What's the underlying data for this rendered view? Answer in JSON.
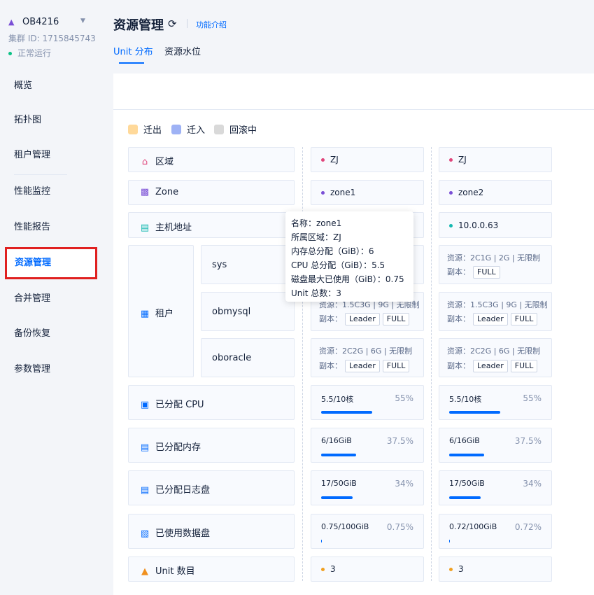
{
  "cluster": {
    "name": "OB4216",
    "id_text": "集群 ID: 1715845743",
    "status": "正常运行",
    "status_color": "#0ac185"
  },
  "nav": [
    {
      "label": "概览"
    },
    {
      "label": "拓扑图"
    },
    {
      "label": "租户管理"
    },
    {
      "label": "性能监控"
    },
    {
      "label": "性能报告"
    },
    {
      "label": "资源管理"
    },
    {
      "label": "合并管理"
    },
    {
      "label": "备份恢复"
    },
    {
      "label": "参数管理"
    }
  ],
  "header": {
    "title": "资源管理",
    "intro_link": "功能介绍"
  },
  "tabs": [
    {
      "label": "Unit 分布",
      "active": true
    },
    {
      "label": "资源水位",
      "active": false
    }
  ],
  "legend": [
    {
      "label": "迁出",
      "color": "#ffd99a"
    },
    {
      "label": "迁入",
      "color": "#9eb2f5"
    },
    {
      "label": "回滚中",
      "color": "#d9d9d9"
    }
  ],
  "rows": {
    "region": "区域",
    "zone": "Zone",
    "host": "主机地址",
    "tenant": "租户",
    "cpu": "已分配 CPU",
    "memory": "已分配内存",
    "log_disk": "已分配日志盘",
    "data_disk": "已使用数据盘",
    "unit_count": "Unit 数目"
  },
  "tenants": [
    "sys",
    "obmysql",
    "oboracle"
  ],
  "replica_label": "副本：",
  "zones": [
    {
      "region": "ZJ",
      "zone": "zone1",
      "host": "",
      "tenants": [
        {
          "resource": "",
          "tags": []
        },
        {
          "resource": "资源：1.5C3G | 9G | 无限制",
          "tags": [
            "Leader",
            "FULL"
          ]
        },
        {
          "resource": "资源：2C2G | 6G | 无限制",
          "tags": [
            "Leader",
            "FULL"
          ]
        }
      ],
      "cpu": {
        "text": "5.5/10核",
        "pct": "55%",
        "fraction": 0.55
      },
      "memory": {
        "text": "6/16GiB",
        "pct": "37.5%",
        "fraction": 0.375
      },
      "log_disk": {
        "text": "17/50GiB",
        "pct": "34%",
        "fraction": 0.34
      },
      "data_disk": {
        "text": "0.75/100GiB",
        "pct": "0.75%",
        "fraction": 0.0075
      },
      "unit_count": "3"
    },
    {
      "region": "ZJ",
      "zone": "zone2",
      "host": "10.0.0.63",
      "tenants": [
        {
          "resource": "资源：2C1G | 2G | 无限制",
          "tags": [
            "FULL"
          ]
        },
        {
          "resource": "资源：1.5C3G | 9G | 无限制",
          "tags": [
            "Leader",
            "FULL"
          ]
        },
        {
          "resource": "资源：2C2G | 6G | 无限制",
          "tags": [
            "Leader",
            "FULL"
          ]
        }
      ],
      "cpu": {
        "text": "5.5/10核",
        "pct": "55%",
        "fraction": 0.55
      },
      "memory": {
        "text": "6/16GiB",
        "pct": "37.5%",
        "fraction": 0.375
      },
      "log_disk": {
        "text": "17/50GiB",
        "pct": "34%",
        "fraction": 0.34
      },
      "data_disk": {
        "text": "0.72/100GiB",
        "pct": "0.72%",
        "fraction": 0.0072
      },
      "unit_count": "3"
    }
  ],
  "tooltip": [
    "名称：zone1",
    "所属区域：ZJ",
    "内存总分配（GiB）：6",
    "CPU 总分配（GiB）：5.5",
    "磁盘最大已使用（GiB）：0.75",
    "Unit 总数：3"
  ]
}
